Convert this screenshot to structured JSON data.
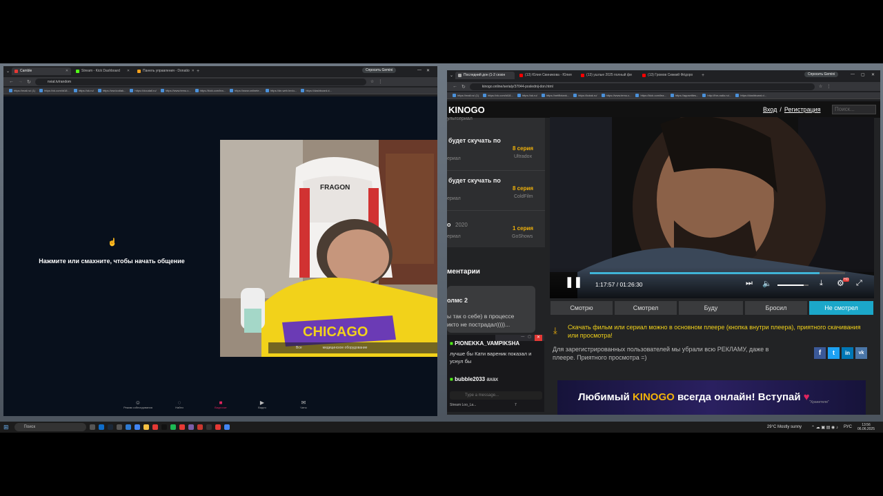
{
  "left_browser": {
    "tabs": [
      {
        "label": "Camble",
        "color": "#e53935"
      },
      {
        "label": "Stream - Kick Dashboard",
        "color": "#53fc18"
      },
      {
        "label": "Панель управления - Donatio",
        "color": "#f7a11b"
      }
    ],
    "gemini_label": "Спросить Gemini",
    "url": "nviat.tv/random",
    "bookmarks": [
      "https://mail.ru/ (1)",
      "https://vk.com/id18...",
      "https://ok.ru/",
      "https://ww.kodiak...",
      "https://cioudall.ru/",
      "https://www.temu.c...",
      "https://kick.com/lea...",
      "https://www.onlinete...",
      "https://dn.web.hm/u...",
      "https://dashboard.d..."
    ],
    "prompt_text": "Нажмите или смахните, чтобы начать общение",
    "overlay_text": "медицинское оборудование",
    "overlay_label": "Все",
    "bottom_nav": [
      {
        "label": "Режим собеседования",
        "icon": "users-icon"
      },
      {
        "label": "Найти",
        "icon": "search-icon"
      },
      {
        "label": "Видеочат",
        "icon": "video-chat-icon",
        "active": true
      },
      {
        "label": "Видео",
        "icon": "play-icon"
      },
      {
        "label": "Чаты",
        "icon": "chat-icon"
      }
    ]
  },
  "right_browser": {
    "tabs": [
      {
        "label": "Последний дон (1-2 сезон",
        "color": "#aaaaaa"
      },
      {
        "label": "(13) Юлия Свиникова - Юлия",
        "color": "#ff0000"
      },
      {
        "label": "(13) ушлые 2025 полный фи",
        "color": "#ff0000"
      },
      {
        "label": "(13) Громов Сижкий Фёдоро",
        "color": "#ff0000"
      }
    ],
    "gemini_label": "Спросить Gemini",
    "url": "kinogo.online/serialy/37044-poslednij-don.html",
    "bookmarks": [
      "https://mail.ru/ (1)",
      "https://vk.com/id18...",
      "https://ok.ru/",
      "https://netflixtank...",
      "https://kotak.ru/",
      "https://www.temu.c...",
      "https://kick.com/lea...",
      "https://appsettles...",
      "http://the-radio.ru/...",
      "https://dashboard.d..."
    ]
  },
  "kinogo": {
    "logo": "KINOGO",
    "login": "Вход",
    "separator": "/",
    "register": "Регистрация",
    "search_placeholder": "Поиск...",
    "partial_top": "ультсериал",
    "list": [
      {
        "title": "будет скучать по",
        "type": "ериал",
        "episode": "8 серия",
        "studio": "Ultradox"
      },
      {
        "title": "будет скучать по",
        "type": "ериал",
        "episode": "8 серия",
        "studio": "ColdFilm"
      },
      {
        "title": "о",
        "year": "2020",
        "type": "ериал",
        "episode": "1 серия",
        "studio": "GoShows"
      }
    ],
    "comments_header": "ментарии",
    "comment": {
      "author": "олмс 2",
      "text": "ы так о себе) в процессе икто не пострадал))))..."
    },
    "player": {
      "time": "1:17:57 / 01:26:30",
      "progress": 0.901,
      "volume": 0.85,
      "quality_badge": "HD"
    },
    "status_tabs": [
      "Смотрю",
      "Смотрел",
      "Буду",
      "Бросил",
      "Не смотрел"
    ],
    "download_note": "Скачать фильм или сериал можно в основном плеере (кнопка внутри плеера), приятного скачивания или просмотра!",
    "ad_note": "Для зарегистрированных пользователей мы убрали всю РЕКЛАМУ, даже в плеере. Приятного просмотра =)",
    "share": [
      "f",
      "t",
      "in",
      "vk"
    ],
    "banner": {
      "pre": "Любимый",
      "brand": "KINOGO",
      "post": "всегда онлайн! Вступай",
      "sub": "\"Хранители\""
    }
  },
  "chat": {
    "messages": [
      {
        "user": "PIONEKKA_VAMPIKSHA",
        "text": "лучше бы Кати вареник показал и уснул бы"
      },
      {
        "user": "bubble2033",
        "text": "ахах"
      }
    ],
    "input_placeholder": "Type a message...",
    "footer": "Stream Loo_La...",
    "viewer_count": "7"
  },
  "taskbar": {
    "search_placeholder": "Поиск",
    "weather": "29°C  Mostly sunny",
    "lang": "РУС",
    "time": "13:56",
    "date": "06.06.2025"
  }
}
